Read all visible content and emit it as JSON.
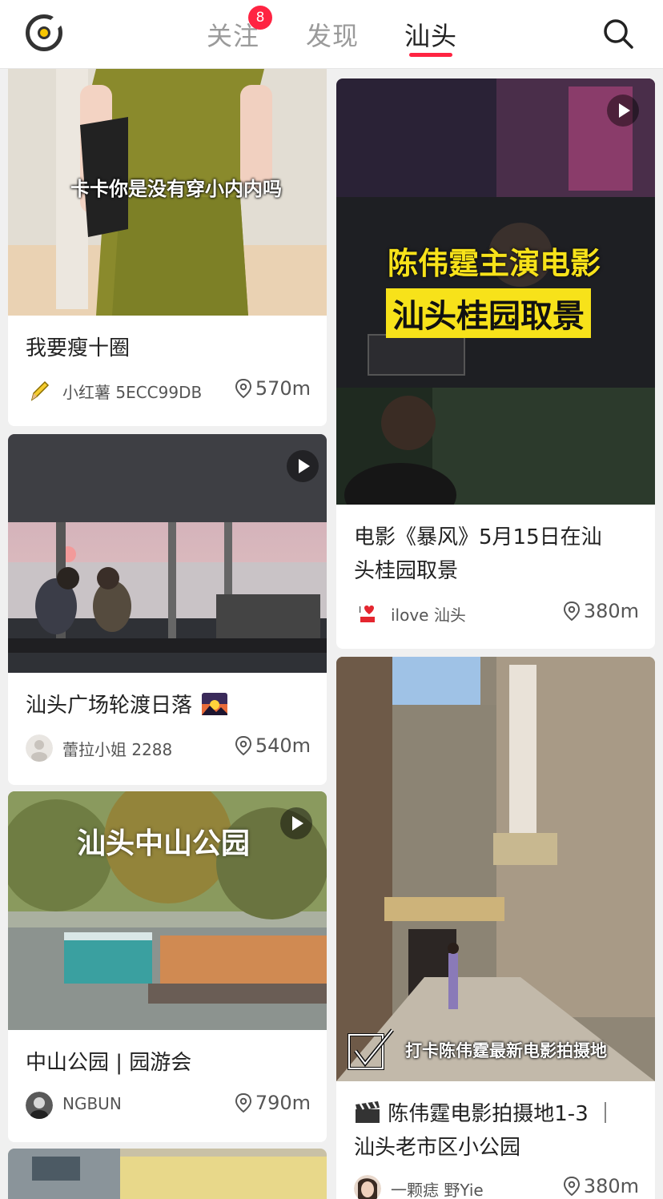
{
  "header": {
    "tabs": [
      {
        "label": "关注",
        "badge": "8"
      },
      {
        "label": "发现"
      },
      {
        "label": "汕头",
        "active": true
      }
    ]
  },
  "feed": {
    "left": [
      {
        "overlay": "卡卡你是没有穿小内内吗",
        "title": "我要瘦十圈",
        "author": "小红薯 5ECC99DB",
        "distance": "570m"
      },
      {
        "overlay": "",
        "title": "汕头广场轮渡日落",
        "author": "蕾拉小姐 2288",
        "distance": "540m"
      },
      {
        "overlay": "汕头中山公园",
        "title": "中山公园 | 园游会",
        "author": "NGBUN",
        "distance": "790m"
      }
    ],
    "right": [
      {
        "overlay_line1": "陈伟霆主演电影",
        "overlay_line2": "汕头桂园取景",
        "title_line1": "电影《暴风》5月15日在汕",
        "title_line2": "头桂园取景",
        "author": "ilove 汕头",
        "distance": "380m"
      },
      {
        "overlay": "打卡陈伟霆最新电影拍摄地",
        "title_line1": "陈伟霆电影拍摄地1-3 ｜",
        "title_line2": "汕头老市区小公园",
        "author": "一颗痣 野Yie",
        "distance": "380m"
      }
    ]
  },
  "colors": {
    "accent": "#ff2442",
    "highlight": "#f7e21a"
  }
}
